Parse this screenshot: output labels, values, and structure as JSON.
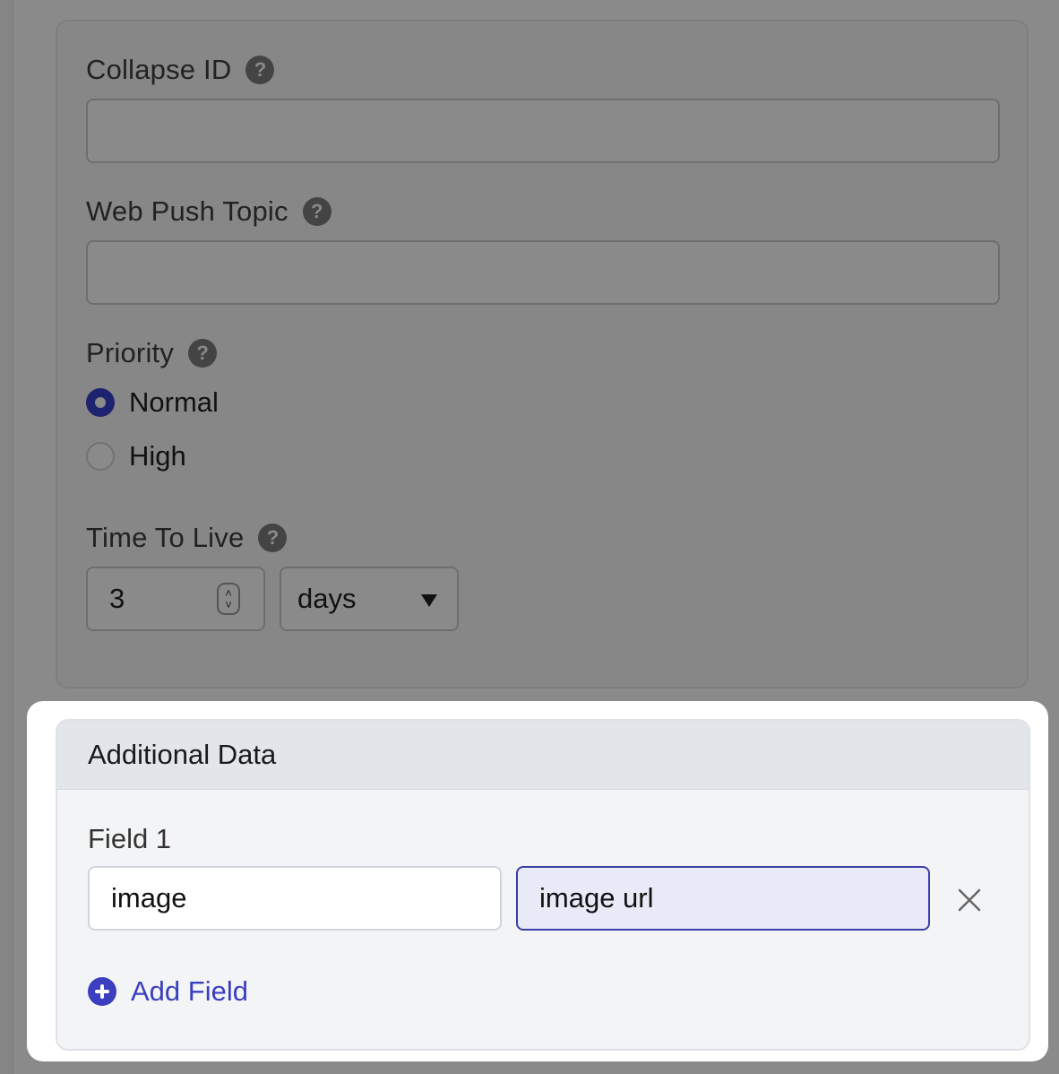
{
  "form": {
    "collapse_id": {
      "label": "Collapse ID",
      "value": ""
    },
    "web_push_topic": {
      "label": "Web Push Topic",
      "value": ""
    },
    "priority": {
      "label": "Priority",
      "options": [
        {
          "label": "Normal",
          "checked": true
        },
        {
          "label": "High",
          "checked": false
        }
      ]
    },
    "time_to_live": {
      "label": "Time To Live",
      "value": "3",
      "unit": "days"
    }
  },
  "additional_data": {
    "title": "Additional Data",
    "fields": [
      {
        "label": "Field 1",
        "key": "image",
        "value": "image url"
      }
    ],
    "add_label": "Add Field"
  },
  "colors": {
    "accent": "#3b3fbf",
    "radio_checked": "#1e2370",
    "overlay": "#8a8a8a"
  }
}
